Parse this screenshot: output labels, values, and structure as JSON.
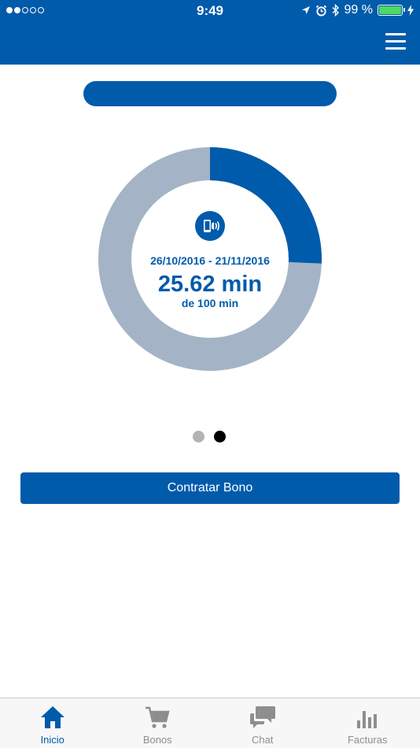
{
  "status_bar": {
    "time": "9:49",
    "battery_text": "99 %",
    "signal_bars_on": 2,
    "signal_bars_total": 5,
    "battery_level": 0.99,
    "icons": [
      "location-arrow-icon",
      "alarm-icon",
      "bluetooth-icon",
      "battery-icon",
      "charging-bolt-icon"
    ]
  },
  "header": {
    "menu_icon": "hamburger-menu-icon"
  },
  "usage_card": {
    "date_range": "26/10/2016 - 21/11/2016",
    "used_text": "25.62 min",
    "total_text": "de 100 min",
    "used_value": 25.62,
    "total_value": 100,
    "icon": "phone-call-icon"
  },
  "pager": {
    "count": 2,
    "active_index": 1
  },
  "cta": {
    "label": "Contratar Bono"
  },
  "tabs": [
    {
      "label": "Inicio",
      "icon": "home-icon",
      "active": true
    },
    {
      "label": "Bonos",
      "icon": "shopping-cart-icon",
      "active": false
    },
    {
      "label": "Chat",
      "icon": "chat-bubbles-icon",
      "active": false
    },
    {
      "label": "Facturas",
      "icon": "bar-chart-icon",
      "active": false
    }
  ],
  "colors": {
    "brand_blue": "#005bab",
    "ring_track": "#a4b4c6",
    "battery_green": "#4cd964",
    "tab_inactive": "#8e8e8e"
  }
}
